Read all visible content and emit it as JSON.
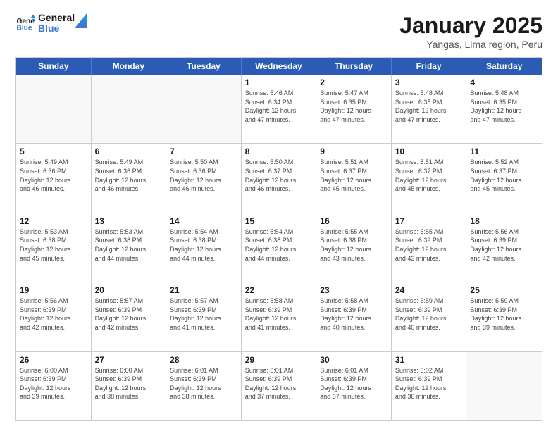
{
  "header": {
    "logo_text_general": "General",
    "logo_text_blue": "Blue",
    "month_year": "January 2025",
    "location": "Yangas, Lima region, Peru"
  },
  "weekdays": [
    "Sunday",
    "Monday",
    "Tuesday",
    "Wednesday",
    "Thursday",
    "Friday",
    "Saturday"
  ],
  "weeks": [
    [
      {
        "day": "",
        "info": ""
      },
      {
        "day": "",
        "info": ""
      },
      {
        "day": "",
        "info": ""
      },
      {
        "day": "1",
        "info": "Sunrise: 5:46 AM\nSunset: 6:34 PM\nDaylight: 12 hours\nand 47 minutes."
      },
      {
        "day": "2",
        "info": "Sunrise: 5:47 AM\nSunset: 6:35 PM\nDaylight: 12 hours\nand 47 minutes."
      },
      {
        "day": "3",
        "info": "Sunrise: 5:48 AM\nSunset: 6:35 PM\nDaylight: 12 hours\nand 47 minutes."
      },
      {
        "day": "4",
        "info": "Sunrise: 5:48 AM\nSunset: 6:35 PM\nDaylight: 12 hours\nand 47 minutes."
      }
    ],
    [
      {
        "day": "5",
        "info": "Sunrise: 5:49 AM\nSunset: 6:36 PM\nDaylight: 12 hours\nand 46 minutes."
      },
      {
        "day": "6",
        "info": "Sunrise: 5:49 AM\nSunset: 6:36 PM\nDaylight: 12 hours\nand 46 minutes."
      },
      {
        "day": "7",
        "info": "Sunrise: 5:50 AM\nSunset: 6:36 PM\nDaylight: 12 hours\nand 46 minutes."
      },
      {
        "day": "8",
        "info": "Sunrise: 5:50 AM\nSunset: 6:37 PM\nDaylight: 12 hours\nand 46 minutes."
      },
      {
        "day": "9",
        "info": "Sunrise: 5:51 AM\nSunset: 6:37 PM\nDaylight: 12 hours\nand 45 minutes."
      },
      {
        "day": "10",
        "info": "Sunrise: 5:51 AM\nSunset: 6:37 PM\nDaylight: 12 hours\nand 45 minutes."
      },
      {
        "day": "11",
        "info": "Sunrise: 5:52 AM\nSunset: 6:37 PM\nDaylight: 12 hours\nand 45 minutes."
      }
    ],
    [
      {
        "day": "12",
        "info": "Sunrise: 5:53 AM\nSunset: 6:38 PM\nDaylight: 12 hours\nand 45 minutes."
      },
      {
        "day": "13",
        "info": "Sunrise: 5:53 AM\nSunset: 6:38 PM\nDaylight: 12 hours\nand 44 minutes."
      },
      {
        "day": "14",
        "info": "Sunrise: 5:54 AM\nSunset: 6:38 PM\nDaylight: 12 hours\nand 44 minutes."
      },
      {
        "day": "15",
        "info": "Sunrise: 5:54 AM\nSunset: 6:38 PM\nDaylight: 12 hours\nand 44 minutes."
      },
      {
        "day": "16",
        "info": "Sunrise: 5:55 AM\nSunset: 6:38 PM\nDaylight: 12 hours\nand 43 minutes."
      },
      {
        "day": "17",
        "info": "Sunrise: 5:55 AM\nSunset: 6:39 PM\nDaylight: 12 hours\nand 43 minutes."
      },
      {
        "day": "18",
        "info": "Sunrise: 5:56 AM\nSunset: 6:39 PM\nDaylight: 12 hours\nand 42 minutes."
      }
    ],
    [
      {
        "day": "19",
        "info": "Sunrise: 5:56 AM\nSunset: 6:39 PM\nDaylight: 12 hours\nand 42 minutes."
      },
      {
        "day": "20",
        "info": "Sunrise: 5:57 AM\nSunset: 6:39 PM\nDaylight: 12 hours\nand 42 minutes."
      },
      {
        "day": "21",
        "info": "Sunrise: 5:57 AM\nSunset: 6:39 PM\nDaylight: 12 hours\nand 41 minutes."
      },
      {
        "day": "22",
        "info": "Sunrise: 5:58 AM\nSunset: 6:39 PM\nDaylight: 12 hours\nand 41 minutes."
      },
      {
        "day": "23",
        "info": "Sunrise: 5:58 AM\nSunset: 6:39 PM\nDaylight: 12 hours\nand 40 minutes."
      },
      {
        "day": "24",
        "info": "Sunrise: 5:59 AM\nSunset: 6:39 PM\nDaylight: 12 hours\nand 40 minutes."
      },
      {
        "day": "25",
        "info": "Sunrise: 5:59 AM\nSunset: 6:39 PM\nDaylight: 12 hours\nand 39 minutes."
      }
    ],
    [
      {
        "day": "26",
        "info": "Sunrise: 6:00 AM\nSunset: 6:39 PM\nDaylight: 12 hours\nand 39 minutes."
      },
      {
        "day": "27",
        "info": "Sunrise: 6:00 AM\nSunset: 6:39 PM\nDaylight: 12 hours\nand 38 minutes."
      },
      {
        "day": "28",
        "info": "Sunrise: 6:01 AM\nSunset: 6:39 PM\nDaylight: 12 hours\nand 38 minutes."
      },
      {
        "day": "29",
        "info": "Sunrise: 6:01 AM\nSunset: 6:39 PM\nDaylight: 12 hours\nand 37 minutes."
      },
      {
        "day": "30",
        "info": "Sunrise: 6:01 AM\nSunset: 6:39 PM\nDaylight: 12 hours\nand 37 minutes."
      },
      {
        "day": "31",
        "info": "Sunrise: 6:02 AM\nSunset: 6:39 PM\nDaylight: 12 hours\nand 36 minutes."
      },
      {
        "day": "",
        "info": ""
      }
    ]
  ]
}
